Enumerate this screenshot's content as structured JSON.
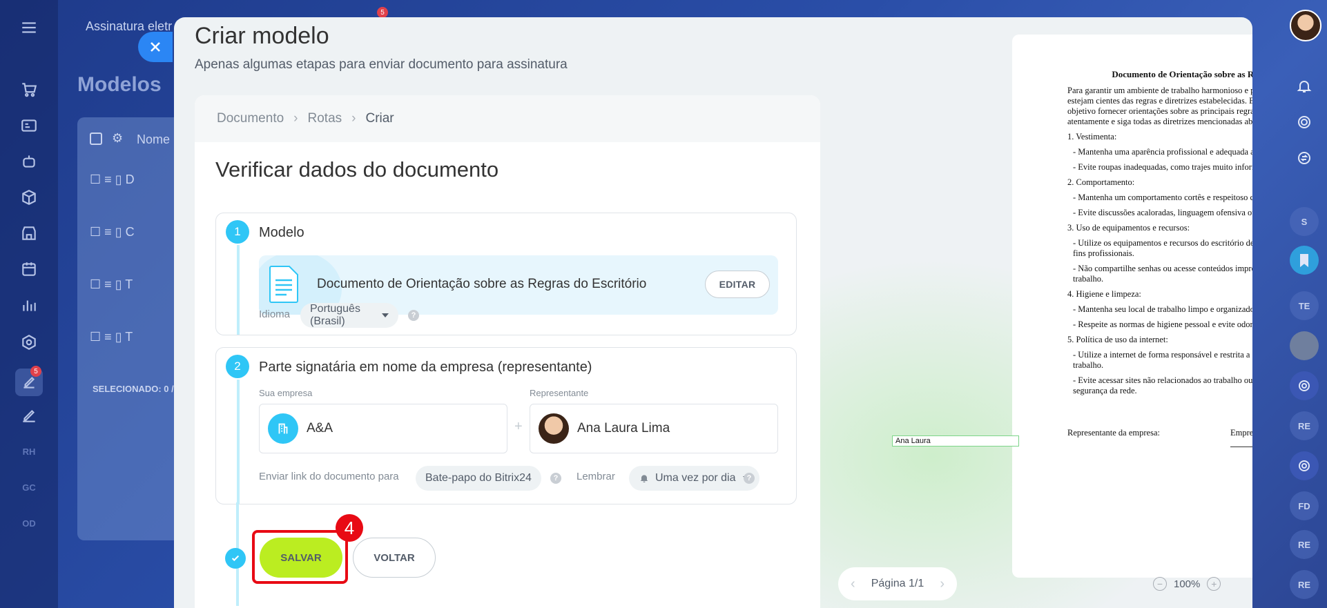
{
  "app": {
    "topbar_title": "Assinatura eletr",
    "page_title_bg": "Modelos",
    "top_badge": "5",
    "bg_column_header": "Nome",
    "bg_selected": "SELECIONADO: 0 /",
    "sidebar_badge": "5",
    "sidebar_text_items": [
      "RH",
      "GC",
      "OD"
    ],
    "bg_row_letters": [
      "D",
      "C",
      "T",
      "T"
    ]
  },
  "modal": {
    "title": "Criar modelo",
    "subtitle": "Apenas algumas etapas para enviar documento para assinatura",
    "breadcrumb": [
      "Documento",
      "Rotas",
      "Criar"
    ],
    "heading": "Verificar dados do documento",
    "step1": {
      "number": "1",
      "title": "Modelo",
      "document_name": "Documento de Orientação sobre as Regras do Escritório",
      "edit_label": "EDITAR",
      "language_label": "Idioma",
      "language_value": "Português (Brasil)",
      "help": "?"
    },
    "step2": {
      "number": "2",
      "title": "Parte signatária em nome da empresa (representante)",
      "company_label": "Sua empresa",
      "company_value": "A&A",
      "representative_label": "Representante",
      "representative_value": "Ana Laura Lima",
      "plus": "+",
      "send_link_label": "Enviar link do documento para",
      "send_link_value": "Bate-papo do Bitrix24",
      "remind_label": "Lembrar",
      "remind_value": "Uma vez por dia",
      "help": "?"
    },
    "save_label": "SALVAR",
    "back_label": "VOLTAR",
    "callout_number": "4"
  },
  "preview": {
    "doc_title": "Documento de Orientação sobre as Regras do Escritório",
    "paragraphs": [
      "Para garantir um ambiente de trabalho harmonioso e produtivo, é importante que todos estejam cientes das regras e diretrizes estabelecidas. Este documento tem como objetivo fornecer orientações sobre as principais regras do escritório. Por favor, leia atentamente e siga todas as diretrizes mencionadas abaixo:",
      "1. Vestimenta:",
      "   - Mantenha uma aparência profissional e adequada ao ambiente de trabalho.",
      "   - Evite roupas inadequadas, como trajes muito informais ou ofensivos.",
      "2. Comportamento:",
      "   - Mantenha um comportamento cortês e respeitoso com todos os colegas de trabalho.",
      "   - Evite discussões acaloradas, linguagem ofensiva ou comportamento inadequado.",
      "3. Uso de equipamentos e recursos:",
      "   - Utilize os equipamentos e recursos do escritório de forma responsável e apenas para fins profissionais.",
      "   - Não compartilhe senhas ou acesse conteúdos impróprios ou não relacionados ao trabalho.",
      "4. Higiene e limpeza:",
      "   - Mantenha seu local de trabalho limpo e organizado.",
      "   - Respeite as normas de higiene pessoal e evite odores fortes ou desagradáveis.",
      "5. Política de uso da internet:",
      "   - Utilize a internet de forma responsável e restrita a atividades relacionadas ao trabalho.",
      "   - Evite acessar sites não relacionados ao trabalho ou que possam comprometer a segurança da rede."
    ],
    "sig_company_label": "Representante da empresa:",
    "sig_employee_label": "Empregado:",
    "sig_name": "Ana Laura",
    "page_label": "Página 1/1",
    "zoom": "100%"
  },
  "right_sidebar": {
    "items": [
      "S",
      "TE",
      "RE",
      "FD",
      "RE",
      "RE"
    ]
  },
  "colors": {
    "accent_blue": "#2fc6f6",
    "save_green": "#bbed21",
    "highlight_red": "#e80a14",
    "close_blue": "#2b86f4"
  }
}
